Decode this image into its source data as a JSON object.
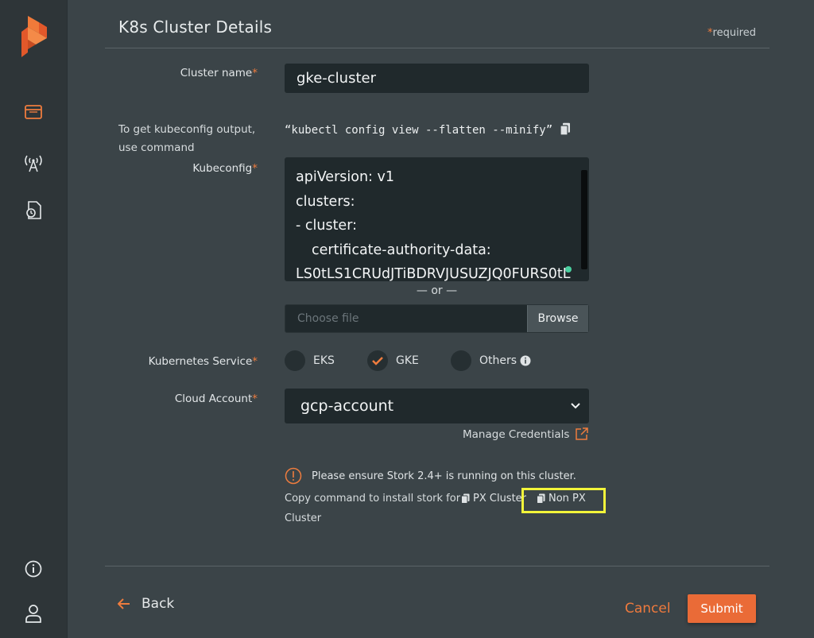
{
  "sidebar": {
    "nav_icons": [
      "clusters-icon",
      "antenna-icon",
      "backup-icon"
    ],
    "bottom_icons": [
      "info-icon",
      "user-icon"
    ]
  },
  "header": {
    "title": "K8s Cluster Details",
    "required_star": "*",
    "required_text": "required"
  },
  "form": {
    "cluster_name": {
      "label": "Cluster name",
      "value": "gke-cluster"
    },
    "kubeconfig_hint": {
      "line1": "To get kubeconfig output,",
      "line2": "use command",
      "command": "“kubectl config view --flatten --minify”"
    },
    "kubeconfig": {
      "label": "Kubeconfig",
      "lines": [
        "apiVersion: v1",
        "clusters:",
        "- cluster:",
        "    certificate-authority-data:",
        "LS0tLS1CRUdJTiBDRVJUSUZJQ0FURS0tL"
      ]
    },
    "or_text": "— or —",
    "file": {
      "placeholder": "Choose file",
      "browse": "Browse"
    },
    "kubernetes_service": {
      "label": "Kubernetes Service",
      "options": [
        "EKS",
        "GKE",
        "Others"
      ],
      "selected": "GKE"
    },
    "cloud_account": {
      "label": "Cloud Account",
      "value": "gcp-account",
      "manage": "Manage Credentials"
    },
    "required_mark": "*"
  },
  "stork": {
    "notice": "Please ensure Stork 2.4+ is running on this cluster.",
    "copy_prefix": "Copy command to install stork for:",
    "px_cluster": "PX Cluster",
    "non_px": "Non PX",
    "cluster_suffix": "Cluster"
  },
  "footer": {
    "back": "Back",
    "cancel": "Cancel",
    "submit": "Submit"
  },
  "colors": {
    "accent": "#ea6b37",
    "highlight": "#f3f53a"
  }
}
